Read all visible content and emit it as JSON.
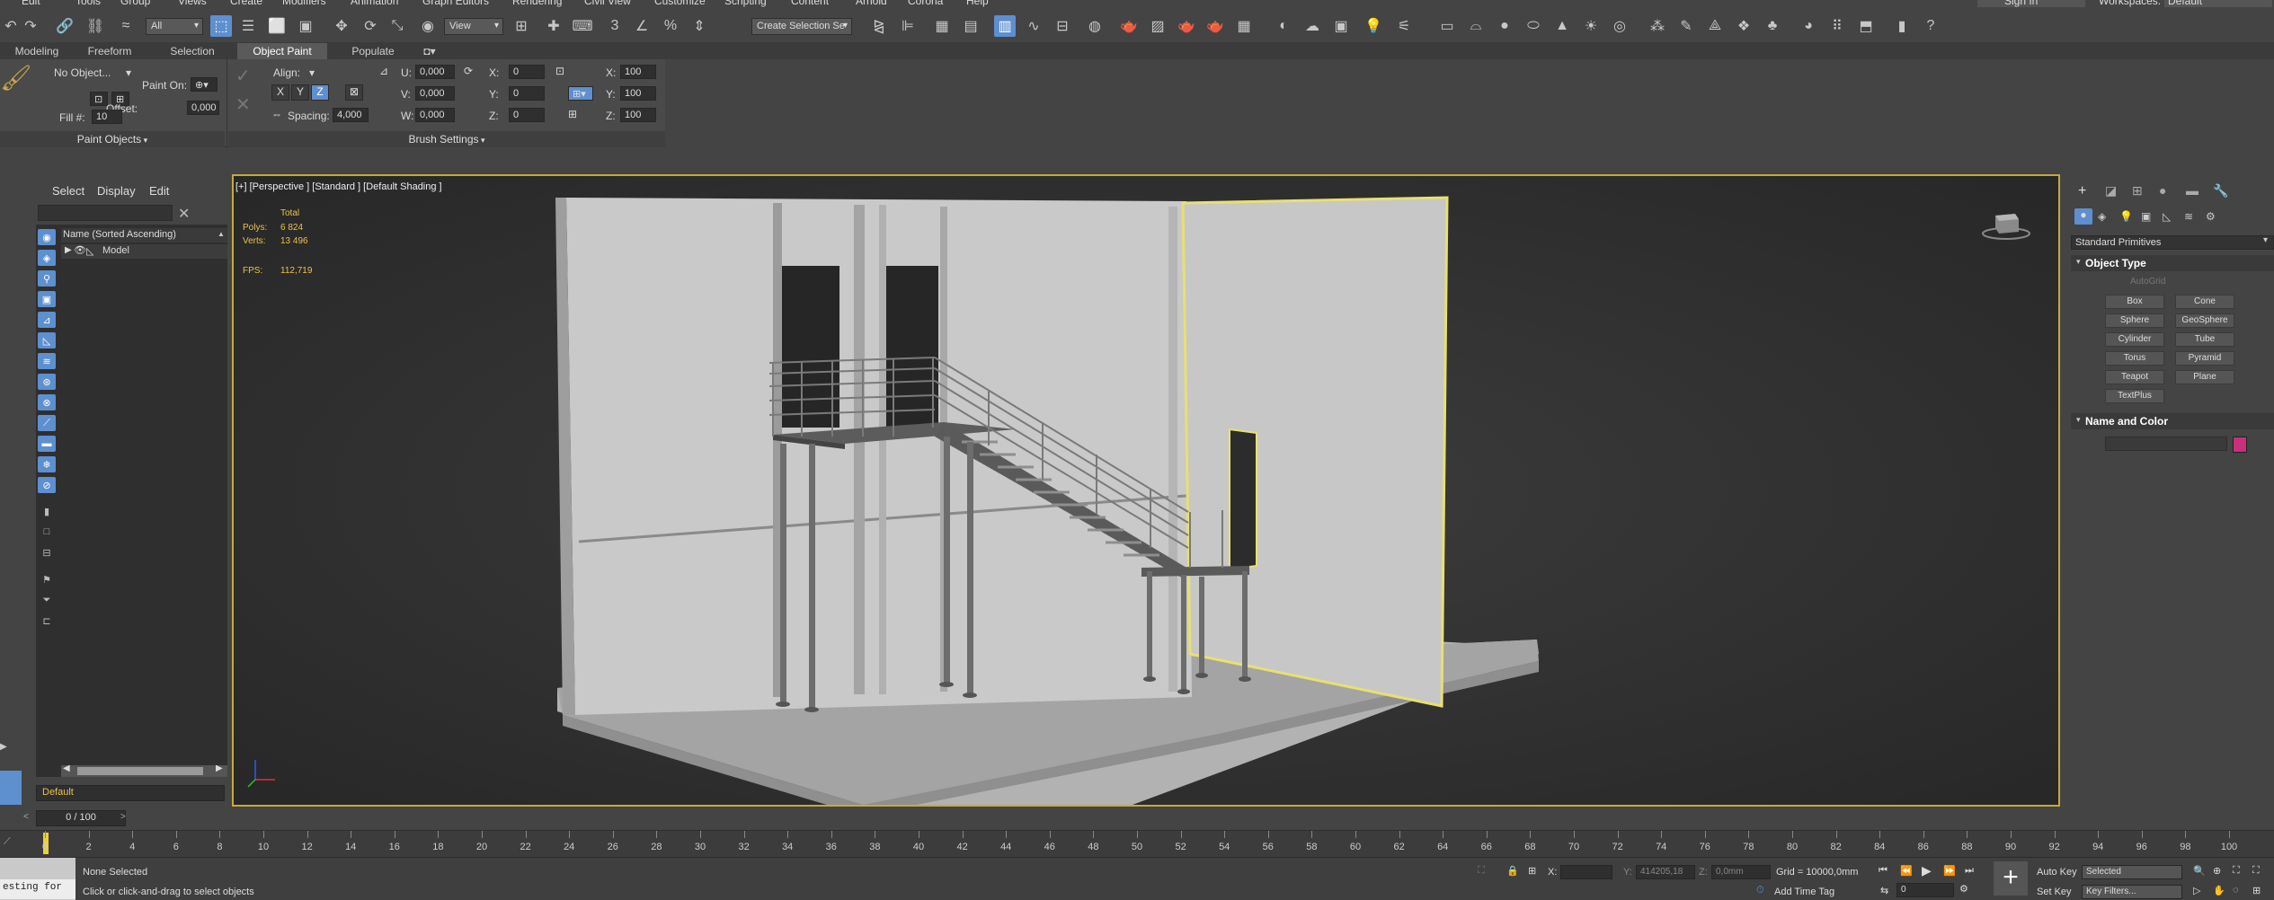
{
  "menubar": {
    "items": [
      "Edit",
      "Tools",
      "Group",
      "Views",
      "Create",
      "Modifiers",
      "Animation",
      "Graph Editors",
      "Rendering",
      "Civil View",
      "Customize",
      "Scripting",
      "Content",
      "Arnold",
      "Corona",
      "Help"
    ],
    "sign_in": "Sign In",
    "workspaces_label": "Workspaces:",
    "workspaces_value": "Default"
  },
  "toolbar": {
    "selection_filter": "All",
    "reference_coord": "View",
    "named_selection": "Create Selection Se"
  },
  "ribbon": {
    "tabs": [
      "Modeling",
      "Freeform",
      "Selection",
      "Object Paint",
      "Populate"
    ],
    "active_tab": "Object Paint",
    "paint_objects": {
      "no_object": "No Object...",
      "paint_on": "Paint On:",
      "fill_label": "Fill #:",
      "fill_value": "10",
      "offset_label": "Offset:",
      "offset_value": "0,000",
      "footer": "Paint Objects"
    },
    "brush_settings": {
      "align_label": "Align:",
      "axes": [
        "X",
        "Y",
        "Z"
      ],
      "active_axis": "Z",
      "spacing_label": "Spacing:",
      "spacing_value": "4,000",
      "u_label": "U:",
      "u_value": "0,000",
      "v_label": "V:",
      "v_value": "0,000",
      "w_label": "W:",
      "w_value": "0,000",
      "rx_label": "X:",
      "rx_value": "0",
      "ry_label": "Y:",
      "ry_value": "0",
      "rz_label": "Z:",
      "rz_value": "0",
      "sx_label": "X:",
      "sx_value": "100",
      "sy_label": "Y:",
      "sy_value": "100",
      "sz_label": "Z:",
      "sz_value": "100",
      "footer": "Brush Settings"
    }
  },
  "explorer": {
    "menu": [
      "Select",
      "Display",
      "Edit"
    ],
    "column_header": "Name (Sorted Ascending)",
    "items": [
      "Model"
    ],
    "layer": "Default",
    "frame_counter": "0 / 100"
  },
  "viewport": {
    "label": "[+] [Perspective ] [Standard ] [Default Shading ]",
    "stats_total": "Total",
    "polys_label": "Polys:",
    "polys_value": "6 824",
    "verts_label": "Verts:",
    "verts_value": "13 496",
    "fps_label": "FPS:",
    "fps_value": "112,719"
  },
  "command_panel": {
    "category": "Standard Primitives",
    "object_type_header": "Object Type",
    "autogrid": "AutoGrid",
    "buttons": [
      "Box",
      "Cone",
      "Sphere",
      "GeoSphere",
      "Cylinder",
      "Tube",
      "Torus",
      "Pyramid",
      "Teapot",
      "Plane",
      "TextPlus"
    ],
    "name_color_header": "Name and Color",
    "object_color": "#c8307a"
  },
  "timeline": {
    "ticks": [
      "0",
      "2",
      "4",
      "6",
      "8",
      "10",
      "12",
      "14",
      "16",
      "18",
      "20",
      "22",
      "24",
      "26",
      "28",
      "30",
      "32",
      "34",
      "36",
      "38",
      "40",
      "42",
      "44",
      "46",
      "48",
      "50",
      "52",
      "54",
      "56",
      "58",
      "60",
      "62",
      "64",
      "66",
      "68",
      "70",
      "72",
      "74",
      "76",
      "78",
      "80",
      "82",
      "84",
      "86",
      "88",
      "90",
      "92",
      "94",
      "96",
      "98",
      "100"
    ]
  },
  "status": {
    "listener": "esting for",
    "selection": "None Selected",
    "prompt": "Click or click-and-drag to select objects",
    "x_label": "X:",
    "x_value": "",
    "y_label": "Y:",
    "y_value": "414205,18",
    "z_label": "Z:",
    "z_value": "0,0mm",
    "grid": "Grid = 10000,0mm",
    "add_time_tag": "Add Time Tag",
    "auto_key": "Auto Key",
    "selected": "Selected",
    "set_key": "Set Key",
    "key_filters": "Key Filters...",
    "frame_field": "0"
  },
  "colors": {
    "accent": "#5e8fcf",
    "viewport_border": "#c8a93a",
    "selection_highlight": "#e8e070"
  }
}
